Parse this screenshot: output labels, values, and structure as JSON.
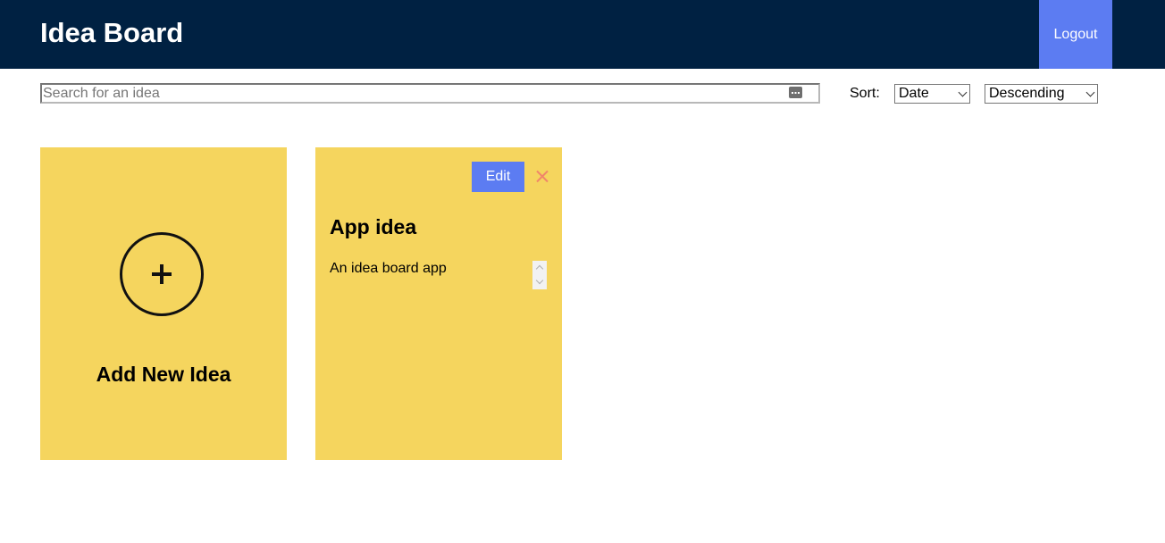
{
  "header": {
    "title": "Idea Board",
    "logout_label": "Logout",
    "background_color": "#002142",
    "accent_color": "#5c7cf2"
  },
  "toolbar": {
    "search": {
      "placeholder": "Search for an idea",
      "value": "",
      "icon": "keyboard-icon"
    },
    "sort_label": "Sort:",
    "sort_field": {
      "selected": "Date"
    },
    "sort_order": {
      "selected": "Descending"
    }
  },
  "cards": {
    "card_color": "#f5d55e",
    "add_card": {
      "icon": "plus-circle-icon",
      "label": "Add New Idea"
    },
    "ideas": [
      {
        "title": "App idea",
        "body": "An idea board app",
        "edit_label": "Edit",
        "delete_icon": "close-icon",
        "delete_color": "#f0866a"
      }
    ]
  }
}
